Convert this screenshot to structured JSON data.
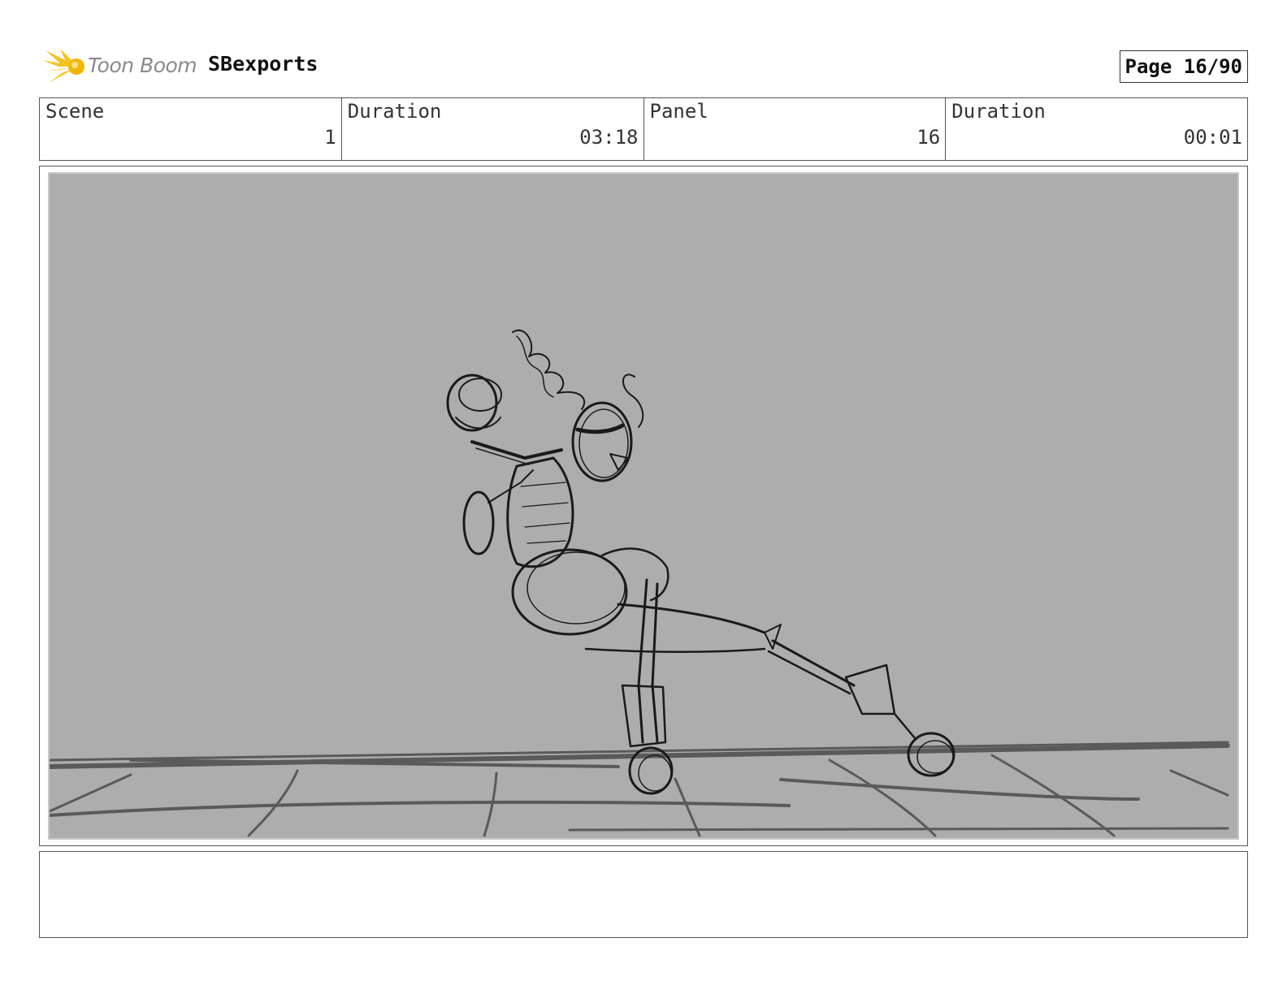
{
  "header": {
    "logo_text": "Toon Boom",
    "project_name": "SBexports",
    "page_label": "Page 16/90"
  },
  "info": [
    {
      "label": "Scene",
      "value": "1"
    },
    {
      "label": "Duration",
      "value": "03:18"
    },
    {
      "label": "Panel",
      "value": "16"
    },
    {
      "label": "Duration",
      "value": "00:01"
    }
  ],
  "panel": {
    "background_color": "#adadad",
    "line_color": "#1a1a1a",
    "floor_color": "#5a5a5a"
  },
  "notes": {
    "text": ""
  }
}
